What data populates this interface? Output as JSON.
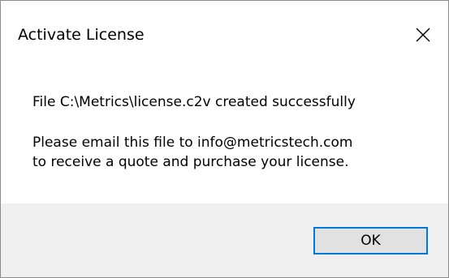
{
  "window": {
    "title": "Activate License",
    "close_icon": "close-x-icon"
  },
  "message": {
    "file_line": "File C:\\Metrics\\license.c2v created successfully",
    "instruction_line1": "Please email this file to info@metricstech.com",
    "instruction_line2": "to receive a quote and purchase your license."
  },
  "buttons": {
    "ok_label": "OK"
  },
  "colors": {
    "footer_bg": "#f0f0f0",
    "button_bg": "#e1e1e1",
    "button_focus_border": "#0078d7",
    "window_border": "#8c8c8c"
  }
}
